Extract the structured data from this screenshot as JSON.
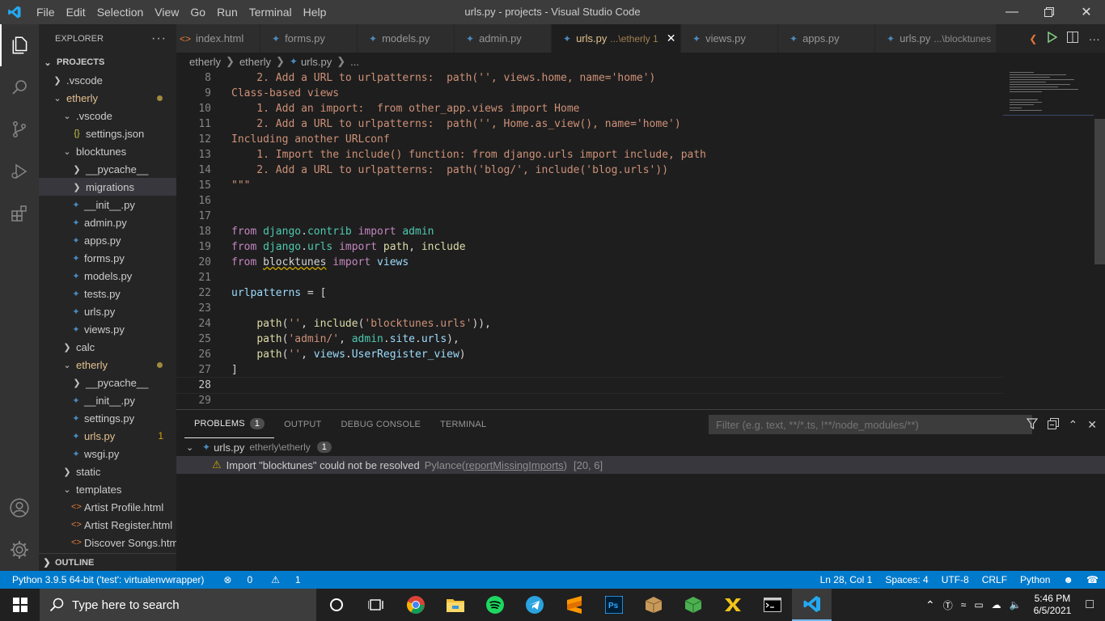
{
  "window": {
    "title": "urls.py - projects - Visual Studio Code",
    "menu": [
      "File",
      "Edit",
      "Selection",
      "View",
      "Go",
      "Run",
      "Terminal",
      "Help"
    ]
  },
  "explorer": {
    "header": "EXPLORER",
    "section": "PROJECTS",
    "outline": "OUTLINE",
    "tree": [
      {
        "label": ".vscode",
        "kind": "folder",
        "open": false,
        "indent": 0
      },
      {
        "label": "etherly",
        "kind": "folder",
        "open": true,
        "indent": 0,
        "modified": true
      },
      {
        "label": ".vscode",
        "kind": "folder",
        "open": true,
        "indent": 1
      },
      {
        "label": "settings.json",
        "kind": "json",
        "indent": 2
      },
      {
        "label": "blocktunes",
        "kind": "folder",
        "open": true,
        "indent": 1
      },
      {
        "label": "__pycache__",
        "kind": "folder",
        "open": false,
        "indent": 2
      },
      {
        "label": "migrations",
        "kind": "folder",
        "open": false,
        "indent": 2,
        "selected": true
      },
      {
        "label": "__init__.py",
        "kind": "py",
        "indent": 2
      },
      {
        "label": "admin.py",
        "kind": "py",
        "indent": 2
      },
      {
        "label": "apps.py",
        "kind": "py",
        "indent": 2
      },
      {
        "label": "forms.py",
        "kind": "py",
        "indent": 2
      },
      {
        "label": "models.py",
        "kind": "py",
        "indent": 2
      },
      {
        "label": "tests.py",
        "kind": "py",
        "indent": 2
      },
      {
        "label": "urls.py",
        "kind": "py",
        "indent": 2
      },
      {
        "label": "views.py",
        "kind": "py",
        "indent": 2
      },
      {
        "label": "calc",
        "kind": "folder",
        "open": false,
        "indent": 1
      },
      {
        "label": "etherly",
        "kind": "folder",
        "open": true,
        "indent": 1,
        "modified": true
      },
      {
        "label": "__pycache__",
        "kind": "folder",
        "open": false,
        "indent": 2
      },
      {
        "label": "__init__.py",
        "kind": "py",
        "indent": 2
      },
      {
        "label": "settings.py",
        "kind": "py",
        "indent": 2
      },
      {
        "label": "urls.py",
        "kind": "py",
        "indent": 2,
        "warn": "1"
      },
      {
        "label": "wsgi.py",
        "kind": "py",
        "indent": 2
      },
      {
        "label": "static",
        "kind": "folder",
        "open": false,
        "indent": 1
      },
      {
        "label": "templates",
        "kind": "folder",
        "open": true,
        "indent": 1
      },
      {
        "label": "Artist Profile.html",
        "kind": "html",
        "indent": 2
      },
      {
        "label": "Artist Register.html",
        "kind": "html",
        "indent": 2
      },
      {
        "label": "Discover Songs.html",
        "kind": "html",
        "indent": 2
      }
    ]
  },
  "tabs": [
    {
      "label": "index.html",
      "icon": "html"
    },
    {
      "label": "forms.py",
      "icon": "py"
    },
    {
      "label": "models.py",
      "icon": "py"
    },
    {
      "label": "admin.py",
      "icon": "py"
    },
    {
      "label": "urls.py",
      "icon": "py",
      "desc": "...\\etherly 1",
      "active": true
    },
    {
      "label": "views.py",
      "icon": "py"
    },
    {
      "label": "apps.py",
      "icon": "py"
    },
    {
      "label": "urls.py",
      "icon": "py",
      "desc": "...\\blocktunes"
    }
  ],
  "breadcrumb": [
    "etherly",
    "etherly",
    "urls.py",
    "..."
  ],
  "editor": {
    "lines": [
      {
        "n": 8
      },
      {
        "n": 9
      },
      {
        "n": 10
      },
      {
        "n": 11
      },
      {
        "n": 12
      },
      {
        "n": 13
      },
      {
        "n": 14
      },
      {
        "n": 15
      },
      {
        "n": 16
      },
      {
        "n": 17
      },
      {
        "n": 18
      },
      {
        "n": 19
      },
      {
        "n": 20
      },
      {
        "n": 21
      },
      {
        "n": 22
      },
      {
        "n": 23
      },
      {
        "n": 24
      },
      {
        "n": 25
      },
      {
        "n": 26
      },
      {
        "n": 27
      },
      {
        "n": 28
      },
      {
        "n": 29
      }
    ]
  },
  "panel": {
    "tabs": [
      {
        "label": "PROBLEMS",
        "badge": "1",
        "active": true
      },
      {
        "label": "OUTPUT"
      },
      {
        "label": "DEBUG CONSOLE"
      },
      {
        "label": "TERMINAL"
      }
    ],
    "filter_placeholder": "Filter (e.g. text, **/*.ts, !**/node_modules/**)",
    "file": {
      "name": "urls.py",
      "path": "etherly\\etherly",
      "count": "1"
    },
    "problem": {
      "message": "Import \"blocktunes\" could not be resolved",
      "source": "Pylance(",
      "code": "reportMissingImports",
      ")": ")",
      "pos": "[20, 6]"
    }
  },
  "status": {
    "interpreter": "Python 3.9.5 64-bit ('test': virtualenvwrapper)",
    "errors": "0",
    "warnings": "1",
    "position": "Ln 28, Col 1",
    "spaces": "Spaces: 4",
    "encoding": "UTF-8",
    "eol": "CRLF",
    "language": "Python"
  },
  "taskbar": {
    "search_placeholder": "Type here to search",
    "time": "5:46 PM",
    "date": "6/5/2021"
  },
  "colors": {
    "accent": "#007acc",
    "modified": "#e2c08d",
    "warning": "#cca700"
  }
}
